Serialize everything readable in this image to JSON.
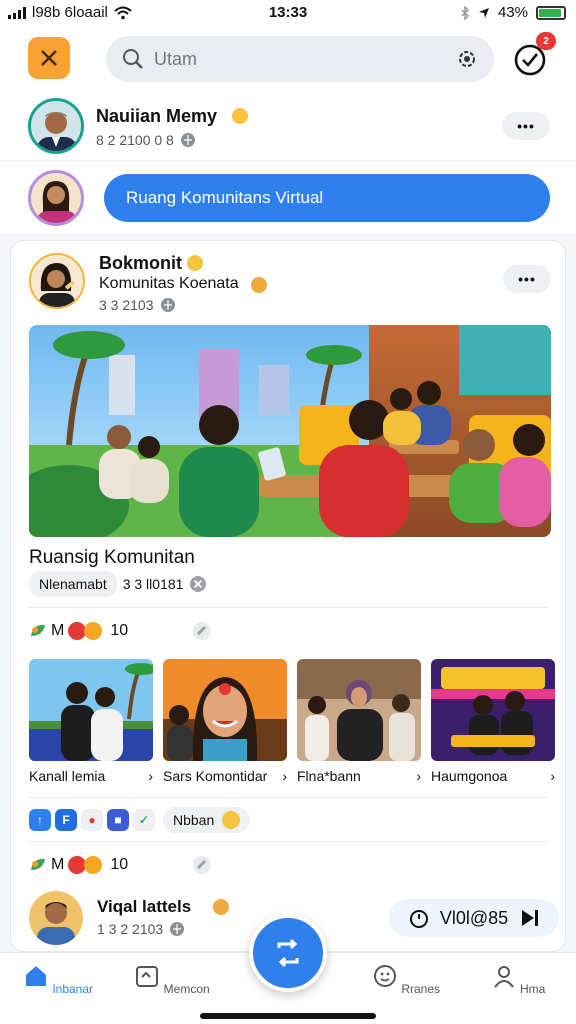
{
  "status_bar": {
    "carrier": "l98b 6loaail",
    "time": "13:33",
    "battery": "43%"
  },
  "search": {
    "placeholder": "Utam"
  },
  "notifications": {
    "count": "2"
  },
  "profile": {
    "name": "Nauiian Memy",
    "meta": "8 2 2100 0 8"
  },
  "community_button": {
    "label": "Ruang Komunitans Virtual"
  },
  "post": {
    "author": "Bokmonit",
    "community": "Komunitas Koenata",
    "meta": "3 3 2103",
    "section_title": "Ruansig Komunitan",
    "tag": "Nlenamabt",
    "tag_meta": "3 3 ll0181"
  },
  "reactions": [
    {
      "letter": "M",
      "count": "10"
    },
    {
      "letter": "M",
      "count": "10"
    }
  ],
  "thumbnails": [
    {
      "label": "Kanall lemia",
      "arrow": "›"
    },
    {
      "label": "Sars Komontidar",
      "arrow": "›"
    },
    {
      "label": "Flna*bann",
      "arrow": "›"
    },
    {
      "label": "Haumgonoa",
      "arrow": "›"
    }
  ],
  "app_row": {
    "pill_label": "Nbban"
  },
  "poster": {
    "name": "Viqal lattels",
    "meta": "1 3 2 2103",
    "play_label": "Vl0l@85"
  },
  "nav": {
    "items": [
      {
        "label": "Inbanar"
      },
      {
        "label": "Memcon"
      },
      {
        "label": "Rranes"
      },
      {
        "label": "Hma"
      }
    ]
  },
  "colors": {
    "accent": "#2f80ed",
    "menu": "#f7a233",
    "badge": "#e53935"
  }
}
